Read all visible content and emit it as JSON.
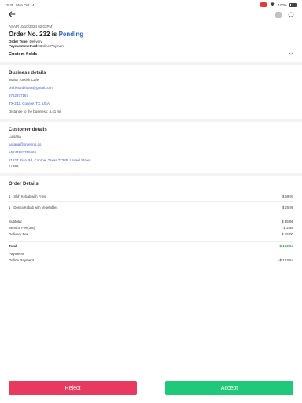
{
  "status_bar": {
    "time": "15:35",
    "date": "Mon Oct 14",
    "battery": "100%"
  },
  "order": {
    "meta": "ASAP(10/10/2024 02:02PM)",
    "title_prefix": "Order No. 232 is ",
    "status": "Pending",
    "order_type_label": "Order Type:",
    "order_type_value": "Delivery",
    "payment_method_label": "Payment method:",
    "payment_method_value": "Online Payment"
  },
  "custom_fields": {
    "label": "Custom fields"
  },
  "business": {
    "heading": "Business details",
    "name": "Waha Turkish Cafe",
    "email": "phil.khanbhana@gmail.com",
    "phone": "8762377167",
    "address": "TX-242, Conroe, TX, USA",
    "distance": "Distance to the business: 4.41 mi"
  },
  "customer": {
    "heading": "Customer details",
    "name": "Luisana",
    "email": "luisana@ordering.co",
    "phone": "+5244887765665",
    "address": "21227 Rian Rd, Conroe, Texas 77385, United States",
    "zip": "77385"
  },
  "order_details": {
    "heading": "Order Details",
    "items": [
      {
        "qty": "1",
        "name": "Shih Kebab with Fries",
        "price": "$ 59.97"
      },
      {
        "qty": "1",
        "name": "Donna Kebab with Vegetables",
        "price": "$ 25.99"
      }
    ]
  },
  "totals": {
    "subtotal_label": "Subtotal",
    "subtotal": "$ 85.96",
    "service_fee_label": "Service Fee(3%)",
    "service_fee": "$ 2.58",
    "delivery_fee_label": "Delivery Fee",
    "delivery_fee": "$ 15.00",
    "total_label": "Total",
    "total": "$ 103.54",
    "payments_label": "Payments",
    "online_payment_label": "Online Payment",
    "online_payment": "-$ 103.54"
  },
  "actions": {
    "reject": "Reject",
    "accept": "Accept"
  },
  "colors": {
    "status": "#2a62d8",
    "link": "#3a5bd9",
    "total": "#2e9b43",
    "reject": "#e83a5e",
    "accept": "#20c97a"
  }
}
